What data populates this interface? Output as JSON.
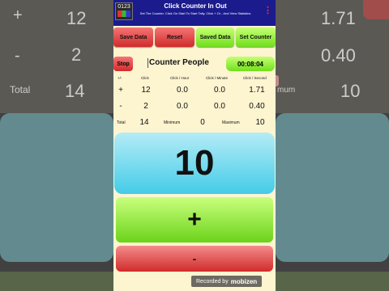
{
  "app": {
    "title": "Click Counter In Out",
    "subtitle": "Set The Counter. Click On Start To Start Tally. Click + Or - And View Statistics",
    "icon_text": "0123",
    "menu_icon": "vertical-dots-icon"
  },
  "toolbar": {
    "save_data": "Save Data",
    "reset": "Reset",
    "saved_data": "Saved Data",
    "set_counter": "Set Counter"
  },
  "session": {
    "stop_label": "Stop",
    "counter_name": "Counter People",
    "elapsed": "00:08:04"
  },
  "stats": {
    "headers": {
      "sign": "+/-",
      "click": "Click",
      "per_hour": "Click / Hour",
      "per_minute": "Click / Minute",
      "per_second": "Click / Second"
    },
    "plus": {
      "sign": "+",
      "click": "12",
      "per_hour": "0.0",
      "per_minute": "0.0",
      "per_second": "1.71"
    },
    "minus": {
      "sign": "-",
      "click": "2",
      "per_hour": "0.0",
      "per_minute": "0.0",
      "per_second": "0.40"
    },
    "total": {
      "label": "Total",
      "value": "14",
      "minimum_label": "Minimum",
      "minimum": "0",
      "maximum_label": "Maximum",
      "maximum": "10"
    }
  },
  "display": {
    "value": "10"
  },
  "controls": {
    "plus": "+",
    "minus": "-"
  },
  "watermark": {
    "text": "Recorded by",
    "brand": "mobizen"
  },
  "background": {
    "left": {
      "plus": "+",
      "plus_click": "12",
      "minus": "-",
      "minus_click": "2",
      "total": "Total",
      "total_value": "14"
    },
    "right": {
      "per_second_plus": "1.71",
      "per_second_minus": "0.40",
      "maximum_fragment": "mum",
      "maximum": "10"
    }
  },
  "colors": {
    "titlebar": "#1b1b8e",
    "red_button": "#d12b2b",
    "green_button": "#6fe01a",
    "display": "#44cce8",
    "app_background": "#fdf4d0"
  }
}
